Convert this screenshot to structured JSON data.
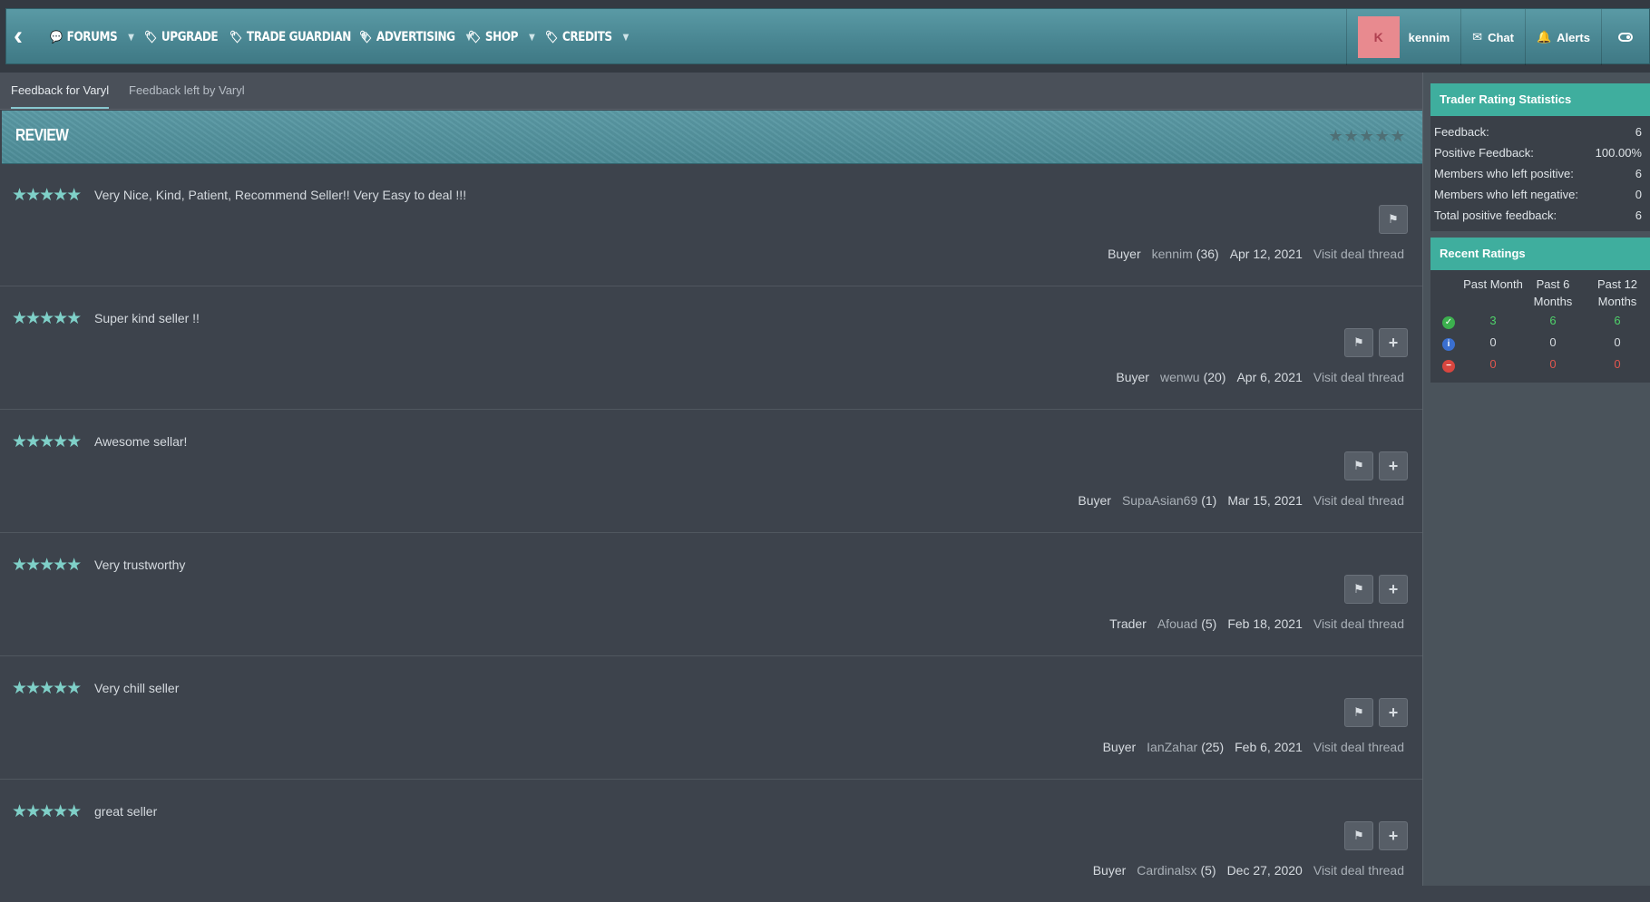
{
  "nav": {
    "items": [
      {
        "label": "FORUMS",
        "icon": "chat-bubbles-icon",
        "has_caret": true
      },
      {
        "label": "UPGRADE",
        "icon": "tag-icon",
        "has_caret": false
      },
      {
        "label": "TRADE GUARDIAN",
        "icon": "tag-icon",
        "has_caret": true
      },
      {
        "label": "ADVERTISING",
        "icon": "tag-icon",
        "has_caret": true
      },
      {
        "label": "SHOP",
        "icon": "tag-icon",
        "has_caret": true
      },
      {
        "label": "CREDITS",
        "icon": "tag-icon",
        "has_caret": true
      }
    ],
    "avatar_letter": "K",
    "username": "kennim",
    "chat": "Chat",
    "alerts": "Alerts"
  },
  "tabs": [
    "Feedback for Varyl",
    "Feedback left by Varyl"
  ],
  "review": {
    "title": "REVIEW"
  },
  "feedback": [
    {
      "comment": "Very Nice, Kind, Patient, Recommend Seller!! Very Easy to deal !!!",
      "role": "Buyer",
      "user": "kennim",
      "count": "(36)",
      "date": "Apr 12, 2021",
      "link": "Visit deal thread",
      "has_plus": false
    },
    {
      "comment": "Super kind seller !!",
      "role": "Buyer",
      "user": "wenwu",
      "count": "(20)",
      "date": "Apr 6, 2021",
      "link": "Visit deal thread",
      "has_plus": true
    },
    {
      "comment": "Awesome sellar!",
      "role": "Buyer",
      "user": "SupaAsian69",
      "count": "(1)",
      "date": "Mar 15, 2021",
      "link": "Visit deal thread",
      "has_plus": true
    },
    {
      "comment": "Very trustworthy",
      "role": "Trader",
      "user": "Afouad",
      "count": "(5)",
      "date": "Feb 18, 2021",
      "link": "Visit deal thread",
      "has_plus": true
    },
    {
      "comment": "Very chill seller",
      "role": "Buyer",
      "user": "IanZahar",
      "count": "(25)",
      "date": "Feb 6, 2021",
      "link": "Visit deal thread",
      "has_plus": true
    },
    {
      "comment": "great seller",
      "role": "Buyer",
      "user": "Cardinalsx",
      "count": "(5)",
      "date": "Dec 27, 2020",
      "link": "Visit deal thread",
      "has_plus": true
    }
  ],
  "stats": {
    "title": "Trader Rating Statistics",
    "rows": [
      {
        "label": "Feedback:",
        "value": "6"
      },
      {
        "label": "Positive Feedback:",
        "value": "100.00%"
      },
      {
        "label": "Members who left positive:",
        "value": "6"
      },
      {
        "label": "Members who left negative:",
        "value": "0"
      },
      {
        "label": "Total positive feedback:",
        "value": "6"
      }
    ]
  },
  "recent": {
    "title": "Recent Ratings",
    "headers": [
      "Past Month",
      "Past 6 Months",
      "Past 12 Months"
    ],
    "rows": [
      {
        "icon": "check-circle-icon",
        "values": [
          "3",
          "6",
          "6"
        ]
      },
      {
        "icon": "info-circle-icon",
        "values": [
          "0",
          "0",
          "0"
        ]
      },
      {
        "icon": "minus-circle-icon",
        "values": [
          "0",
          "0",
          "0"
        ]
      }
    ]
  },
  "colors": {
    "accent": "#3fae9e",
    "nav": "#4a8793",
    "star": "#7fd0c8",
    "positive": "#4fd16a",
    "negative": "#e0564e"
  }
}
